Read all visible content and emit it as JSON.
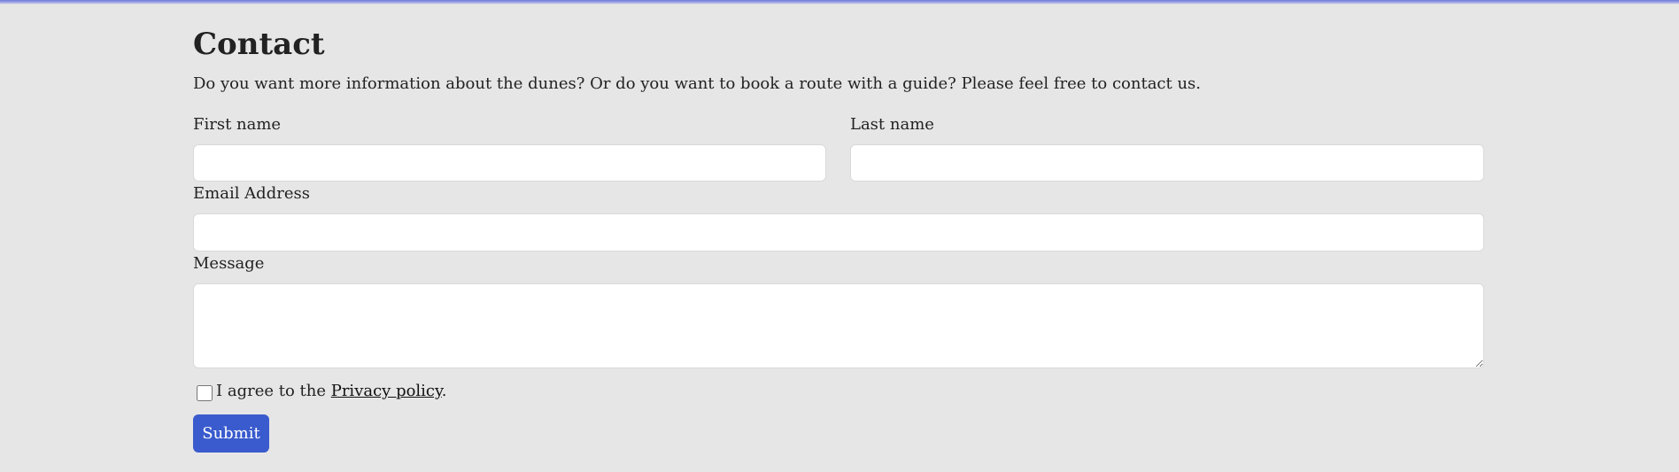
{
  "contact": {
    "title": "Contact",
    "intro": "Do you want more information about the dunes? Or do you want to book a route with a guide? Please feel free to contact us.",
    "first_name": {
      "label": "First name",
      "value": "",
      "placeholder": ""
    },
    "last_name": {
      "label": "Last name",
      "value": "",
      "placeholder": ""
    },
    "email": {
      "label": "Email Address",
      "value": "",
      "placeholder": ""
    },
    "message": {
      "label": "Message",
      "value": "",
      "placeholder": ""
    },
    "agree": {
      "prefix": "I agree to the ",
      "link_text": "Privacy policy",
      "suffix": ".",
      "checked": false
    },
    "submit_label": "Submit"
  },
  "colors": {
    "background": "#e6e6e6",
    "accent": "#3a5bcd",
    "top_bar": "#6f79dd",
    "text": "#222222"
  }
}
